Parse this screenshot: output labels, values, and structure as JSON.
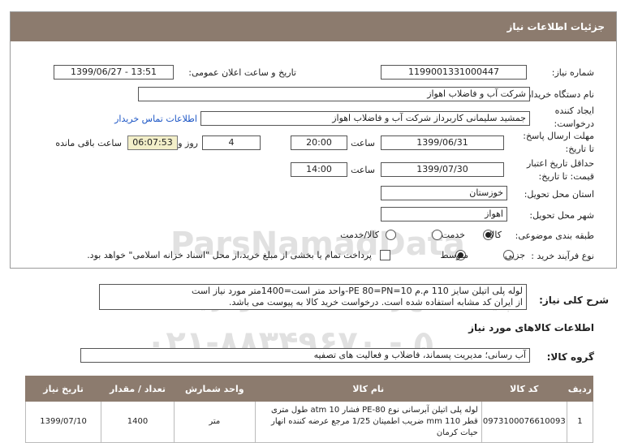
{
  "header": {
    "title": "جزئیات اطلاعات نیاز"
  },
  "form": {
    "need_number_label": "شماره نیاز:",
    "need_number": "1199001331000447",
    "announce_label": "تاریخ و ساعت اعلان عمومی:",
    "announce_value": "1399/06/27 - 13:51",
    "buyer_label": "نام دستگاه خریدار:",
    "buyer_value": "شرکت آب و فاضلاب اهواز",
    "creator_label_1": "ایجاد کننده",
    "creator_label_2": "درخواست:",
    "creator_value": "جمشید سلیمانی کاربرداز شرکت آب و فاضلاب اهواز",
    "contact_link": "اطلاعات تماس خریدار",
    "deadline_label_1": "مهلت ارسال پاسخ:",
    "deadline_label_2": "تا تاریخ:",
    "deadline_date": "1399/06/31",
    "time_label": "ساعت",
    "deadline_time": "20:00",
    "days_value": "4",
    "days_label": "روز و",
    "remaining_value": "06:07:53",
    "remaining_label": "ساعت باقی مانده",
    "validity_label_1": "حداقل تاریخ اعتبار",
    "validity_label_2": "قیمت: تا تاریخ:",
    "validity_date": "1399/07/30",
    "validity_time": "14:00",
    "province_label": "استان محل تحویل:",
    "province_value": "خوزستان",
    "city_label": "شهر محل تحویل:",
    "city_value": "اهواز",
    "category_label": "طبقه بندی موضوعی:",
    "category_options": [
      "کالا",
      "خدمت",
      "کالا/خدمت"
    ],
    "category_selected": "کالا",
    "process_label": "نوع فرآیند خرید :",
    "process_options": [
      "جزیی",
      "متوسط"
    ],
    "process_selected": "متوسط",
    "payment_note": "پرداخت تمام یا بخشی از مبلغ خرید،از محل \"اسناد خزانه اسلامی\" خواهد بود."
  },
  "description": {
    "label": "شرح کلی نیاز:",
    "lines": [
      "لوله پلی اتیلن سایز 110 م.م PE 80=PN=10-واحد متر است=1400متر مورد نیاز است",
      "از ایران کد مشابه استفاده شده است. درخواست خرید کالا به پیوست می باشد."
    ]
  },
  "goods": {
    "section_title": "اطلاعات کالاهای مورد نیاز",
    "group_label": "گروه کالا:",
    "group_value": "آب رسانی؛ مدیریت پسماند، فاضلاب و فعالیت های تصفیه",
    "columns": [
      "ردیف",
      "کد کالا",
      "نام کالا",
      "واحد شمارش",
      "تعداد / مقدار",
      "تاریخ نیاز"
    ],
    "rows": [
      {
        "row": "1",
        "code": "0973100076610093",
        "name": "لوله پلی اتیلن آبرسانی نوع PE-80 فشار 10 atm طول متری قطر 110 mm ضریب اطمینان 1/25 مرجع عرضه کننده انهار حیات کرمان",
        "unit": "متر",
        "qty": "1400",
        "date": "1399/07/10"
      }
    ]
  },
  "watermark": {
    "brand": "ParsNamadData",
    "phone": "۰۲۱-۸۸۳۴۹۶۷۰ - ۵",
    "caption": "پایگاه اطلاع رسانی مناقصات و مزایده"
  }
}
